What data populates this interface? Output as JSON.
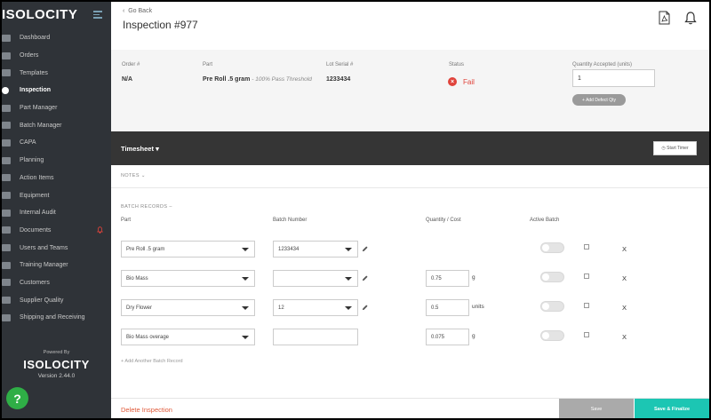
{
  "sidebar": {
    "logo": "ISOLOCITY",
    "items": [
      {
        "label": "Dashboard",
        "icon": "dashboard-icon"
      },
      {
        "label": "Orders",
        "icon": "orders-icon"
      },
      {
        "label": "Templates",
        "icon": "templates-icon"
      },
      {
        "label": "Inspection",
        "icon": "eye-icon",
        "active": true
      },
      {
        "label": "Part Manager",
        "icon": "gear-icon"
      },
      {
        "label": "Batch Manager",
        "icon": "batch-icon"
      },
      {
        "label": "CAPA",
        "icon": "capa-icon"
      },
      {
        "label": "Planning",
        "icon": "map-icon"
      },
      {
        "label": "Action Items",
        "icon": "checkbox-icon"
      },
      {
        "label": "Equipment",
        "icon": "wrench-icon"
      },
      {
        "label": "Internal Audit",
        "icon": "audit-icon"
      },
      {
        "label": "Documents",
        "icon": "folder-icon"
      },
      {
        "label": "Users and Teams",
        "icon": "users-icon"
      },
      {
        "label": "Training Manager",
        "icon": "training-icon"
      },
      {
        "label": "Customers",
        "icon": "tag-icon"
      },
      {
        "label": "Supplier Quality",
        "icon": "supplier-icon"
      },
      {
        "label": "Shipping and Receiving",
        "icon": "truck-icon"
      }
    ],
    "powered_by": "Powered By",
    "footer_logo": "ISOLOCITY",
    "version": "Version 2.44.0",
    "help": "?"
  },
  "header": {
    "back": "Go Back",
    "title": "Inspection #977"
  },
  "info": {
    "order_label": "Order #",
    "order_value": "N/A",
    "part_label": "Part",
    "part_value": "Pre Roll .5 gram",
    "part_threshold": "- 100% Pass Threshold",
    "lot_label": "Lot Serial #",
    "lot_value": "1233434",
    "status_label": "Status",
    "status_value": "Fail",
    "qty_label": "Quantity Accepted (units)",
    "qty_value": "1",
    "add_defect": "+ Add Defect Qty"
  },
  "timesheet": {
    "label": "Timesheet",
    "start_timer": "Start Timer"
  },
  "notes_label": "NOTES",
  "batch": {
    "title": "BATCH RECORDS",
    "headers": {
      "part": "Part",
      "batch": "Batch Number",
      "qty": "Quantity / Cost",
      "active": "Active Batch"
    },
    "rows": [
      {
        "part": "Pre Roll .5 gram",
        "batch": "1233434",
        "qty": "",
        "unit": ""
      },
      {
        "part": "Bio Mass",
        "batch": "",
        "qty": "0.75",
        "unit": "g"
      },
      {
        "part": "Dry Flower",
        "batch": "12",
        "qty": "0.5",
        "unit": "units"
      },
      {
        "part": "Bio Mass overage",
        "batch": "",
        "qty": "0.075",
        "unit": "g"
      }
    ],
    "delete_mark": "X",
    "add_record": "+ Add Another Batch Record"
  },
  "footer": {
    "delete": "Delete Inspection",
    "save": "Save",
    "save_finalize": "Save & Finalize"
  },
  "colors": {
    "accent": "#1cc6b3",
    "fail": "#e0433b",
    "sidebar": "#2f3338"
  }
}
